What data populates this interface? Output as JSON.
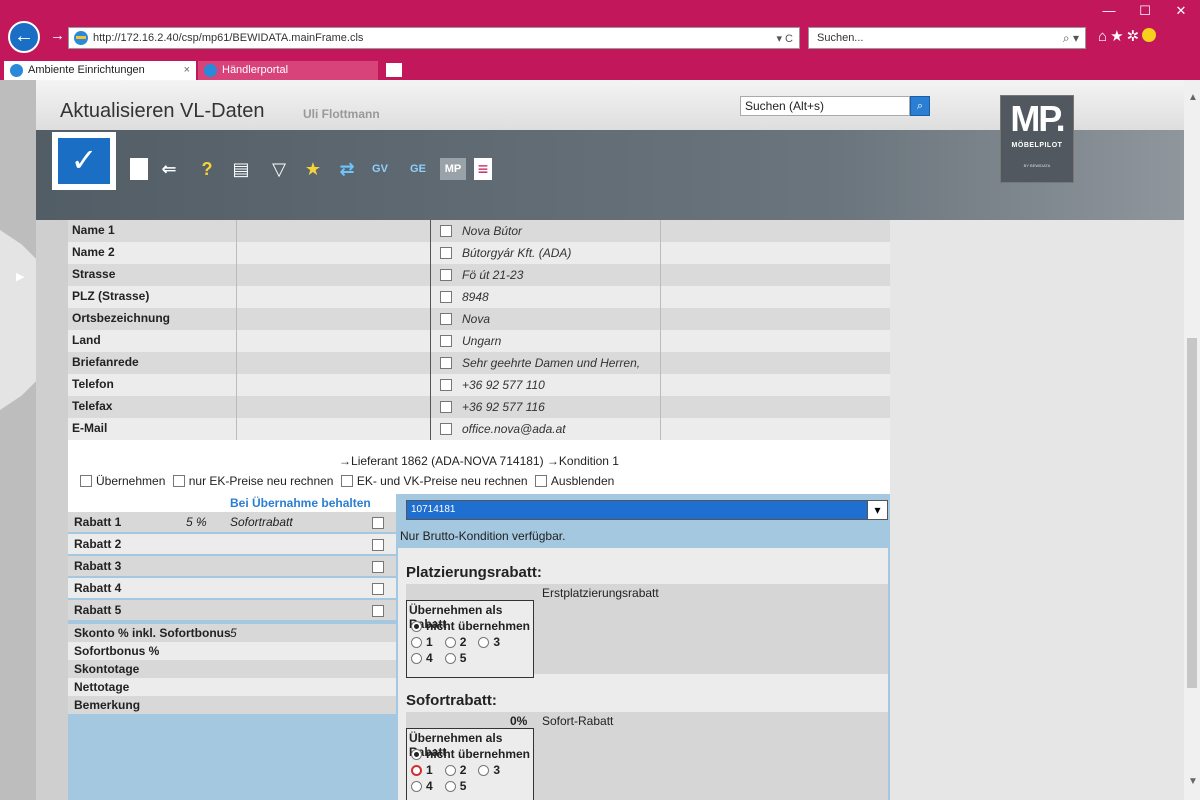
{
  "browser": {
    "url": "http://172.16.2.40/csp/mp61/BEWIDATA.mainFrame.cls",
    "address_tools": "▾ C",
    "search_placeholder": "Suchen...",
    "search_tools": "⌕ ▾",
    "tabs": [
      {
        "label": "Ambiente Einrichtungen",
        "close": "×"
      },
      {
        "label": "Händlerportal"
      }
    ],
    "window_controls": [
      "—",
      "☐",
      "✕"
    ]
  },
  "header": {
    "title": "Aktualisieren VL-Daten",
    "user": "Uli Flottmann",
    "search_placeholder": "Suchen (Alt+s)",
    "logo_main": "MP.",
    "logo_sub": "MÖBELPILOT",
    "logo_by": "BY BEWIDATA"
  },
  "toolbar": {
    "save_glyph": "✓",
    "icons": [
      {
        "name": "new-document-icon",
        "glyph": "▯"
      },
      {
        "name": "back-icon",
        "glyph": "⇐"
      },
      {
        "name": "help-icon",
        "glyph": "?"
      },
      {
        "name": "print-icon",
        "glyph": "▤"
      },
      {
        "name": "filter-icon",
        "glyph": "▽"
      },
      {
        "name": "favorite-list-icon",
        "glyph": "★"
      },
      {
        "name": "transfer-icon",
        "glyph": "⇄"
      },
      {
        "name": "gv-icon",
        "glyph": "GV"
      },
      {
        "name": "ge-icon",
        "glyph": "GE"
      },
      {
        "name": "moebelpilot-icon",
        "glyph": "MP"
      },
      {
        "name": "document-icon",
        "glyph": "≡"
      }
    ]
  },
  "address": {
    "rows": [
      {
        "label": "Name 1",
        "value": "Nova Bútor"
      },
      {
        "label": "Name 2",
        "value": "Bútorgyár Kft. (ADA)"
      },
      {
        "label": "Strasse",
        "value": "Fö út 21-23"
      },
      {
        "label": "PLZ (Strasse)",
        "value": "8948"
      },
      {
        "label": "Ortsbezeichnung",
        "value": "Nova"
      },
      {
        "label": "Land",
        "value": "Ungarn"
      },
      {
        "label": "Briefanrede",
        "value": "Sehr geehrte Damen und Herren,"
      },
      {
        "label": "Telefon",
        "value": "+36 92 577 110"
      },
      {
        "label": "Telefax",
        "value": "+36 92 577 116"
      },
      {
        "label": "E-Mail",
        "value": "office.nova@ada.at"
      }
    ]
  },
  "lieferant_line": "→Lieferant 1862 (ADA-NOVA 714181)  →Kondition 1",
  "options": [
    "Übernehmen",
    "nur EK-Preise neu rechnen",
    "EK- und VK-Preise neu rechnen",
    "Ausblenden"
  ],
  "left_panel": {
    "header": "Bei Übernahme behalten",
    "rabatte": [
      {
        "label": "Rabatt 1",
        "pct": "5 %",
        "desc": "Sofortrabatt"
      },
      {
        "label": "Rabatt 2",
        "pct": "",
        "desc": ""
      },
      {
        "label": "Rabatt 3",
        "pct": "",
        "desc": ""
      },
      {
        "label": "Rabatt 4",
        "pct": "",
        "desc": ""
      },
      {
        "label": "Rabatt 5",
        "pct": "",
        "desc": ""
      }
    ],
    "extra": [
      {
        "label": "Skonto % inkl. Sofortbonus",
        "value": "5"
      },
      {
        "label": "Sofortbonus %",
        "value": ""
      },
      {
        "label": "Skontotage",
        "value": ""
      },
      {
        "label": "Nettotage",
        "value": ""
      },
      {
        "label": "Bemerkung",
        "value": ""
      }
    ]
  },
  "right_panel": {
    "select_value": "10714181",
    "select_arrow": "▾",
    "note": "Nur Brutto-Kondition verfügbar.",
    "sections": [
      {
        "title": "Platzierungsrabatt:",
        "pct": "",
        "desc": "Erstplatzierungsrabatt",
        "radio_header": "Übernehmen als Rabatt",
        "radio_none": "nicht übernehmen",
        "radio_labels": [
          "1",
          "2",
          "3",
          "4",
          "5"
        ]
      },
      {
        "title": "Sofortrabatt:",
        "pct": "0%",
        "desc": "Sofort-Rabatt",
        "radio_header": "Übernehmen als Rabatt",
        "radio_none": "nicht übernehmen",
        "radio_labels": [
          "1",
          "2",
          "3",
          "4",
          "5"
        ]
      }
    ]
  }
}
